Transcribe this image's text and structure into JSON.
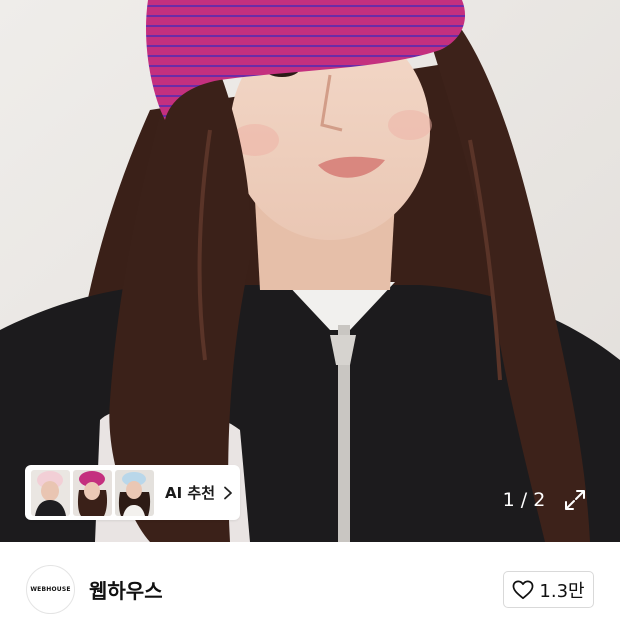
{
  "ai_recommend": {
    "label": "AI 추천",
    "thumbnails": [
      {
        "icon": "model-white-hat-thumbnail"
      },
      {
        "icon": "model-pink-beanie-thumbnail"
      },
      {
        "icon": "model-blue-cap-thumbnail"
      }
    ],
    "chevron_icon": "chevron-right-icon"
  },
  "gallery": {
    "current_page": 1,
    "total_pages": 2,
    "counter_text": "1 / 2",
    "expand_icon": "expand-icon"
  },
  "brand": {
    "name": "웹하우스",
    "logo_text": "WEBHOUSE"
  },
  "like": {
    "count": "1.3만",
    "icon": "heart-outline-icon"
  },
  "colors": {
    "accent_pink": "#c0297a",
    "text": "#111111",
    "border": "#d9d9d9"
  }
}
